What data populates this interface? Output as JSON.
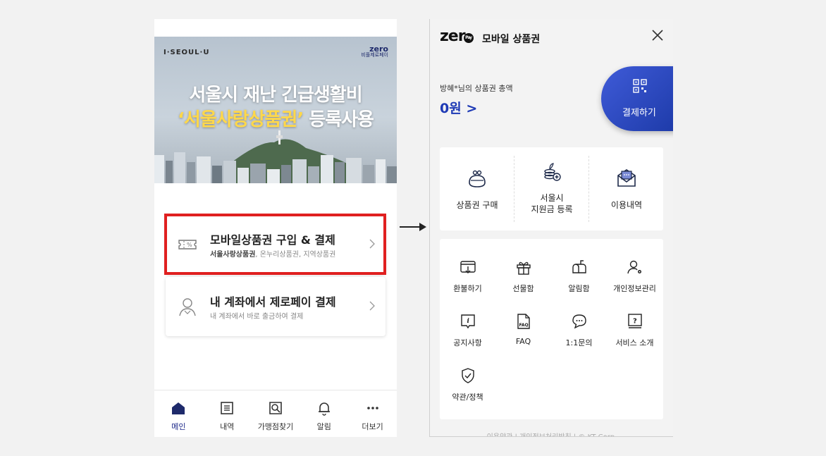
{
  "left": {
    "banner": {
      "brand": "I·SEOUL·U",
      "zero_logo": "zero",
      "zero_sub": "비플제로페이",
      "line1": "서울시 재난 긴급생활비",
      "line2_highlight": "‘서울사랑상품권’",
      "line2_rest": " 등록사용"
    },
    "menu": [
      {
        "title": "모바일상품권 구입 & 결제",
        "sub_bold": "서울사랑상품권",
        "sub_rest": ", 온누리상품권, 지역상품권",
        "icon": "ticket-icon"
      },
      {
        "title": "내 계좌에서 제로페이 결제",
        "sub_bold": "",
        "sub_rest": "내 계좌에서 바로 출금하여 결제",
        "icon": "person-icon"
      }
    ],
    "tabs": [
      {
        "label": "메인",
        "icon": "home-icon"
      },
      {
        "label": "내역",
        "icon": "list-icon"
      },
      {
        "label": "가맹점찾기",
        "icon": "store-search-icon"
      },
      {
        "label": "알림",
        "icon": "bell-icon"
      },
      {
        "label": "더보기",
        "icon": "more-icon"
      }
    ],
    "active_color": "#1e2a8a"
  },
  "right": {
    "logo": "zer",
    "logo_badge": "Pay",
    "title": "모바일 상품권",
    "balance_label": "방혜*님의 상품권 총액",
    "balance_value": "0원 >",
    "pay_button": "결제하기",
    "top_items": [
      {
        "label": "상품권 구매",
        "icon": "wallet-icon"
      },
      {
        "label": "서울시\n지원금 등록",
        "icon": "coins-plus-icon"
      },
      {
        "label": "이용내역",
        "icon": "envelope-icon"
      }
    ],
    "grid_items": [
      {
        "label": "환불하기",
        "icon": "refund-icon"
      },
      {
        "label": "선물함",
        "icon": "gift-icon"
      },
      {
        "label": "알림함",
        "icon": "mailbox-icon"
      },
      {
        "label": "개인정보관리",
        "icon": "user-settings-icon"
      },
      {
        "label": "공지사항",
        "icon": "notice-icon"
      },
      {
        "label": "FAQ",
        "icon": "faq-icon"
      },
      {
        "label": "1:1문의",
        "icon": "chat-icon"
      },
      {
        "label": "서비스 소개",
        "icon": "help-book-icon"
      },
      {
        "label": "약관/정책",
        "icon": "shield-check-icon"
      }
    ],
    "footer": "이용약관  |  개인정보처리방침  |  © KT Corp.",
    "accent_color": "#1e3ab5"
  }
}
